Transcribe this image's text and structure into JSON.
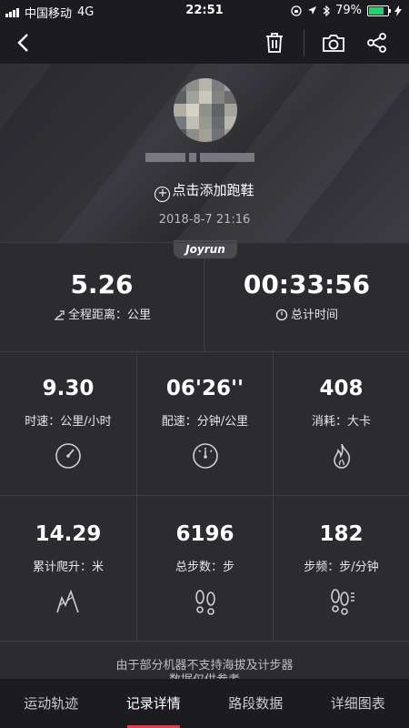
{
  "status_bar": {
    "carrier": "中国移动",
    "network": "4G",
    "time": "22:51",
    "battery_percent": "79%",
    "battery_level": 0.79
  },
  "nav": {
    "back_icon": "chevron-left-icon",
    "delete_icon": "trash-icon",
    "camera_icon": "camera-icon",
    "share_icon": "share-icon"
  },
  "profile": {
    "add_shoe_label": "点击添加跑鞋",
    "date": "2018-8-7 21:16"
  },
  "brand_tab": "Joyrun",
  "summary": {
    "distance_value": "5.26",
    "distance_label": "全程距离：公里",
    "time_value": "00:33:56",
    "time_label": "总计时间"
  },
  "metrics": [
    {
      "value": "9.30",
      "label": "时速：公里/小时",
      "icon": "speedometer-icon"
    },
    {
      "value": "06'26''",
      "label": "配速：分钟/公里",
      "icon": "pace-gauge-icon"
    },
    {
      "value": "408",
      "label": "消耗：大卡",
      "icon": "flame-icon"
    },
    {
      "value": "14.29",
      "label": "累计爬升：米",
      "icon": "mountain-icon"
    },
    {
      "value": "6196",
      "label": "总步数：步",
      "icon": "footprints-icon"
    },
    {
      "value": "182",
      "label": "步频：步/分钟",
      "icon": "footprint-cadence-icon"
    }
  ],
  "note": {
    "line1": "由于部分机器不支持海拔及计步器",
    "line2": "数据仅供参考"
  },
  "tabs": [
    {
      "label": "运动轨迹"
    },
    {
      "label": "记录详情"
    },
    {
      "label": "路段数据"
    },
    {
      "label": "详细图表"
    }
  ],
  "active_tab": "记录详情",
  "colors": {
    "background": "#2b2b30",
    "bar": "#1c1c20",
    "accent": "#e8384f",
    "battery": "#2ecc71"
  }
}
